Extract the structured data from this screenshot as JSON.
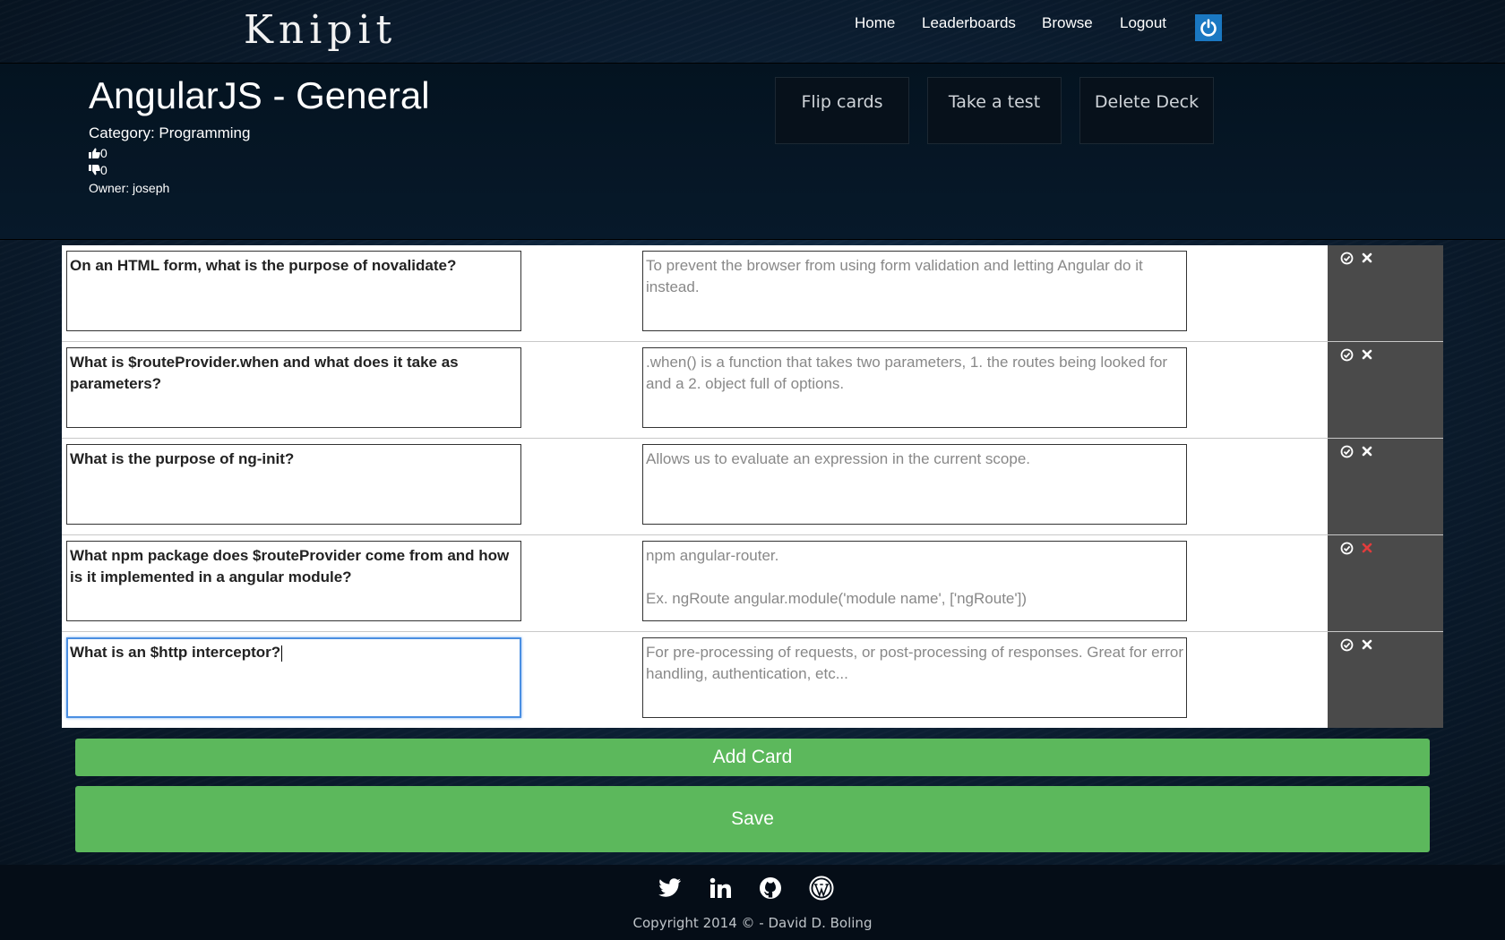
{
  "app": {
    "logo": "Knipit"
  },
  "nav": {
    "home": "Home",
    "leaderboards": "Leaderboards",
    "browse": "Browse",
    "logout": "Logout",
    "power_icon": "power-icon"
  },
  "deck": {
    "title": "AngularJS - General",
    "category": "Category: Programming",
    "likes": "0",
    "dislikes": "0",
    "owner": "Owner: joseph"
  },
  "actions": {
    "flip": "Flip cards",
    "test": "Take a test",
    "delete": "Delete Deck"
  },
  "cards": [
    {
      "question": "On an HTML form, what is the purpose of novalidate?",
      "answer": "To prevent the browser from using form validation and letting Angular do it instead."
    },
    {
      "question": "What is $routeProvider.when and what does it take as parameters?",
      "answer": ".when() is a function that takes two parameters, 1. the routes being looked for and a 2. object full of options."
    },
    {
      "question": "What is the purpose of ng-init?",
      "answer": "Allows us to evaluate an expression in the current scope."
    },
    {
      "question": "What npm package does $routeProvider come from and how is it implemented in a angular module?",
      "answer": "npm angular-router.\n\nEx. ngRoute angular.module('module name', ['ngRoute'])"
    },
    {
      "question": "What is an $http interceptor?",
      "answer": "For pre-processing of requests, or post-processing of responses. Great for error handling, authentication, etc..."
    }
  ],
  "card_icons": {
    "confirm": "check-circle-icon",
    "remove": "close-icon",
    "remove_hover_color": "#e03c3c"
  },
  "buttons": {
    "add_card": "Add Card",
    "save": "Save"
  },
  "colors": {
    "accent_green": "#5cb85c",
    "power_blue": "#1a78c2",
    "control_gray": "#4a4a4a"
  },
  "footer": {
    "icons": [
      "twitter-icon",
      "linkedin-icon",
      "github-icon",
      "wordpress-icon"
    ],
    "copyright": "Copyright 2014 © - David D. Boling"
  }
}
